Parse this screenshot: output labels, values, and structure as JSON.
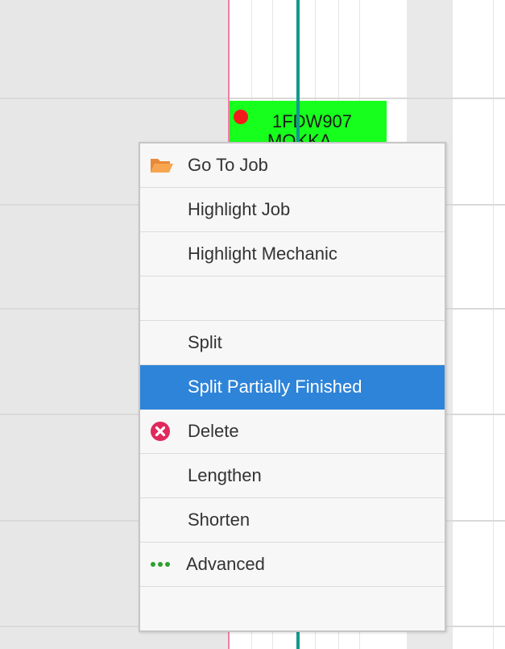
{
  "job_block": {
    "code": "1FDW907",
    "name": "MOKKA",
    "color": "#17ff1c",
    "status_dot_color": "#f21a1a"
  },
  "context_menu": {
    "items": [
      {
        "label": "Go To Job",
        "icon": "folder-open-icon",
        "icon_color": "#f5a04a"
      },
      {
        "label": "Highlight Job"
      },
      {
        "label": "Highlight Mechanic"
      },
      {
        "label": ""
      },
      {
        "label": "Split"
      },
      {
        "label": "Split Partially Finished",
        "highlighted": true,
        "highlight_color": "#2e84d8"
      },
      {
        "label": "Delete",
        "icon": "delete-x-circle-icon",
        "icon_color": "#e0295c"
      },
      {
        "label": "Lengthen"
      },
      {
        "label": "Shorten"
      },
      {
        "label": "Advanced",
        "icon": "more-dots-icon",
        "icon_color": "#2ca02c"
      },
      {
        "label": ""
      }
    ]
  }
}
